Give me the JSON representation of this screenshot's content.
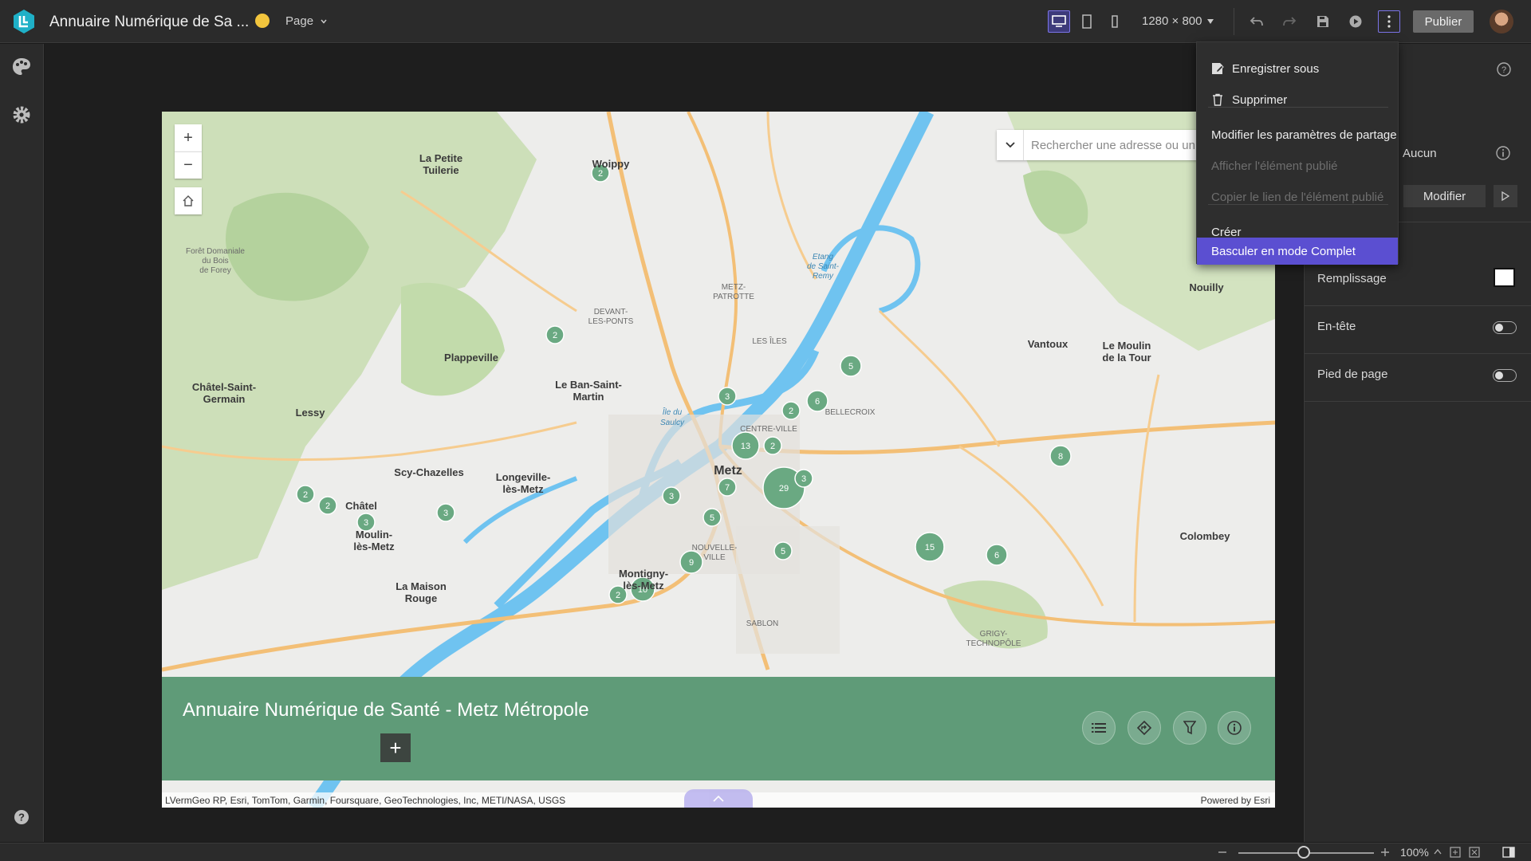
{
  "header": {
    "app_title": "Annuaire Numérique de Sa ...",
    "page_selector": "Page",
    "resolution": "1280 × 800",
    "publish_label": "Publier"
  },
  "menu": {
    "items": [
      {
        "label": "Enregistrer sous",
        "state": "enabled",
        "icon": "save-as-icon"
      },
      {
        "label": "Supprimer",
        "state": "enabled",
        "icon": "trash-icon"
      },
      {
        "label": "Modifier les paramètres de partage",
        "state": "enabled"
      },
      {
        "label": "Afficher l'élément publié",
        "state": "disabled"
      },
      {
        "label": "Copier le lien de l'élément publié",
        "state": "disabled"
      },
      {
        "label": "Créer",
        "state": "enabled"
      },
      {
        "label": "Basculer en mode Complet",
        "state": "active"
      }
    ]
  },
  "map": {
    "search_placeholder": "Rechercher une adresse ou un l...",
    "header_title": "Annuaire Numérique de Santé - Metz Métropole",
    "attribution_left": "LVermGeo RP, Esri, TomTom, Garmin, Foursquare, GeoTechnologies, Inc, METI/NASA, USGS",
    "attribution_right": "Powered by Esri",
    "place_labels": [
      "La Petite Tuilerie",
      "Woippy",
      "Forêt Domaniale du Bois de Forey",
      "Plappeville",
      "Le Ban-Saint-Martin",
      "Châtel-Saint-Germain",
      "Lessy",
      "Scy-Chazelles",
      "Longeville-lès-Metz",
      "Châtel",
      "Moulin-lès-Metz",
      "La Maison Rouge",
      "Metz",
      "Montigny-lès-Metz",
      "Vantoux",
      "Le Moulin de la Tour",
      "Nouilly",
      "Colombey",
      "Sablon",
      "Centre-Ville",
      "Bellecroix",
      "Nouvelle-Ville",
      "Les Îles",
      "Metz-Patrotte",
      "Devant-les-Ponts",
      "Grigy-Technopôle",
      "Île du Saulcy",
      "Etang de Saint-Remy"
    ],
    "clusters": [
      "2",
      "2",
      "2",
      "2",
      "3",
      "3",
      "3",
      "13",
      "2",
      "29",
      "7",
      "3",
      "5",
      "9",
      "10",
      "2",
      "5",
      "15",
      "6",
      "8",
      "6",
      "2",
      "5",
      "3"
    ]
  },
  "panel": {
    "aucun": "Aucun",
    "modifier": "Modifier",
    "remplissage": "Remplissage",
    "entete": "En-tête",
    "pied_de_page": "Pied de page"
  },
  "status": {
    "zoom": "100%"
  },
  "colors": {
    "accent": "#5b4fd1",
    "header_green": "#5f9b78",
    "cluster_green": "#6aa982"
  }
}
